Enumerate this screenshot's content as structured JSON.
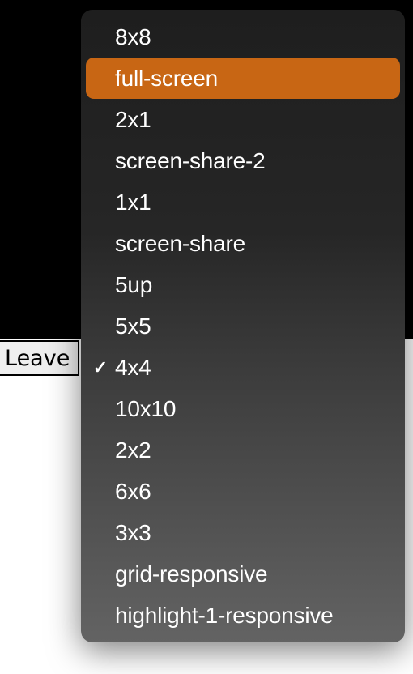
{
  "leave_button_label": "Leave",
  "menu": {
    "items": [
      {
        "label": "8x8",
        "checked": false,
        "highlighted": false
      },
      {
        "label": "full-screen",
        "checked": false,
        "highlighted": true
      },
      {
        "label": "2x1",
        "checked": false,
        "highlighted": false
      },
      {
        "label": "screen-share-2",
        "checked": false,
        "highlighted": false
      },
      {
        "label": "1x1",
        "checked": false,
        "highlighted": false
      },
      {
        "label": "screen-share",
        "checked": false,
        "highlighted": false
      },
      {
        "label": "5up",
        "checked": false,
        "highlighted": false
      },
      {
        "label": "5x5",
        "checked": false,
        "highlighted": false
      },
      {
        "label": "4x4",
        "checked": true,
        "highlighted": false
      },
      {
        "label": "10x10",
        "checked": false,
        "highlighted": false
      },
      {
        "label": "2x2",
        "checked": false,
        "highlighted": false
      },
      {
        "label": "6x6",
        "checked": false,
        "highlighted": false
      },
      {
        "label": "3x3",
        "checked": false,
        "highlighted": false
      },
      {
        "label": "grid-responsive",
        "checked": false,
        "highlighted": false
      },
      {
        "label": "highlight-1-responsive",
        "checked": false,
        "highlighted": false
      }
    ]
  }
}
